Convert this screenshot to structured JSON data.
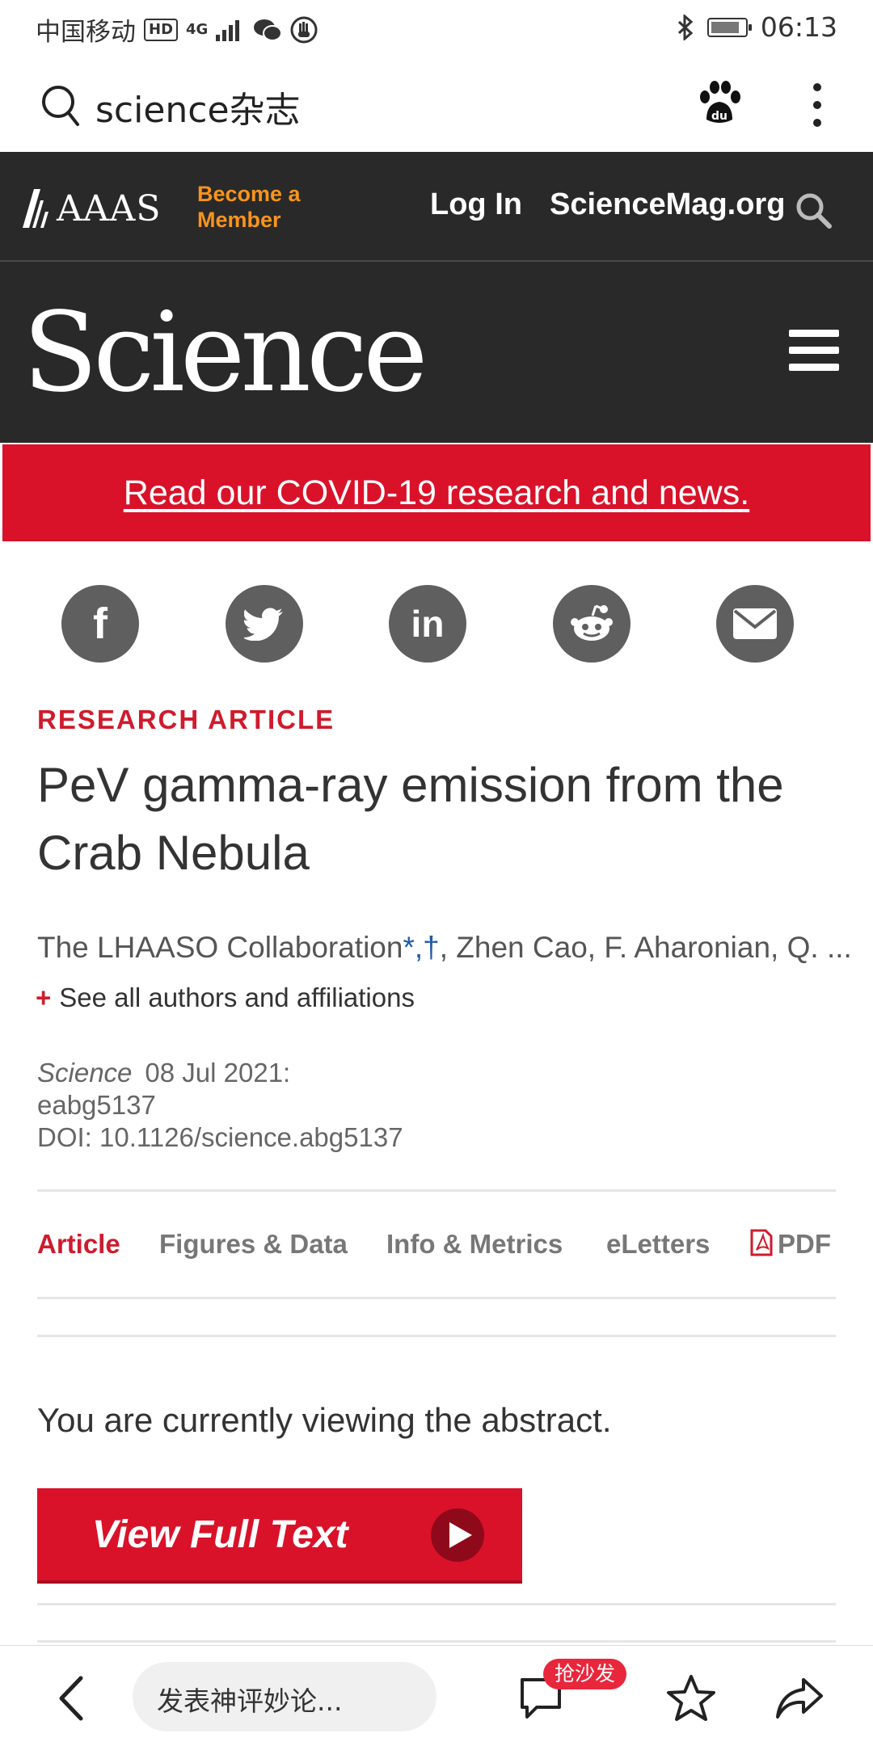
{
  "status_bar": {
    "carrier": "中国移动",
    "hd_badge": "HD",
    "network": "4G",
    "time": "06:13"
  },
  "browser": {
    "query": "science杂志"
  },
  "aaas_header": {
    "logo_text": "AAAS",
    "become_line1": "Become a",
    "become_line2": "Member",
    "login": "Log In",
    "sciencemag": "ScienceMag.org"
  },
  "masthead": {
    "logo": "Science"
  },
  "covid_banner": {
    "text": "Read our COVID-19 research and news."
  },
  "share": {
    "icons": [
      "facebook-icon",
      "twitter-icon",
      "linkedin-icon",
      "reddit-icon",
      "email-icon"
    ],
    "facebook_glyph": "f",
    "linkedin_glyph": "in"
  },
  "article": {
    "kicker": "RESEARCH ARTICLE",
    "title": "PeV gamma-ray emission from the Crab Nebula",
    "authors_lead": "The LHAASO Collaboration",
    "authors_marks": "*,†",
    "authors_rest": ", Zhen Cao, F. Aharonian, Q. ...",
    "see_all_plus": "+",
    "see_all": "See all authors and affiliations",
    "journal": "Science",
    "date": "08 Jul 2021:",
    "article_id": "eabg5137",
    "doi": "DOI: 10.1126/science.abg5137"
  },
  "tabs": {
    "article": "Article",
    "figures": "Figures & Data",
    "info": "Info & Metrics",
    "eletters": "eLetters",
    "pdf": "PDF"
  },
  "abstract_note": "You are currently viewing the abstract.",
  "full_text_button": "View Full Text",
  "bottom_bar": {
    "comment_placeholder": "发表神评妙论...",
    "sofa_badge": "抢沙发"
  },
  "colors": {
    "brand_red": "#d9122a",
    "header_dark": "#292929",
    "become_orange": "#f7941d"
  }
}
